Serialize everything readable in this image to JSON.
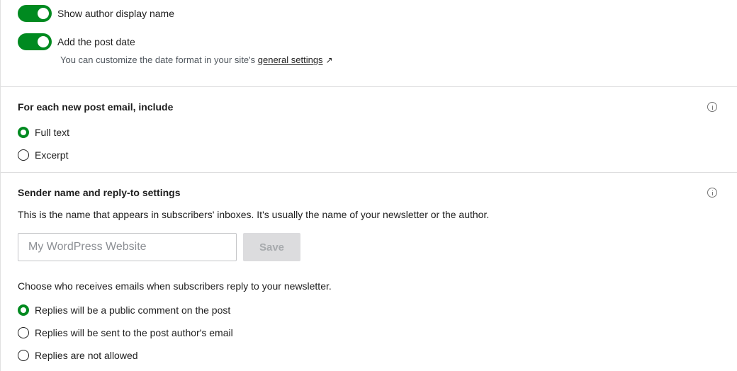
{
  "colors": {
    "accent": "#008a20"
  },
  "toggles": [
    {
      "label": "Show author display name",
      "on": true
    },
    {
      "label": "Add the post date",
      "on": true
    }
  ],
  "date_help": {
    "prefix": "You can customize the date format in your site's ",
    "link_text": "general settings",
    "link_icon": "↗",
    "icon_name": "external-link-icon"
  },
  "post_email": {
    "title": "For each new post email, include",
    "info_icon": "info-icon",
    "options": [
      {
        "label": "Full text",
        "selected": true
      },
      {
        "label": "Excerpt",
        "selected": false
      }
    ]
  },
  "sender": {
    "title": "Sender name and reply-to settings",
    "info_icon": "info-icon",
    "description": "This is the name that appears in subscribers' inboxes. It's usually the name of your newsletter or the author.",
    "name_input": {
      "placeholder": "My WordPress Website",
      "value": ""
    },
    "save_label": "Save",
    "reply_description": "Choose who receives emails when subscribers reply to your newsletter.",
    "reply_options": [
      {
        "label": "Replies will be a public comment on the post",
        "selected": true
      },
      {
        "label": "Replies will be sent to the post author's email",
        "selected": false
      },
      {
        "label": "Replies are not allowed",
        "selected": false
      }
    ]
  }
}
